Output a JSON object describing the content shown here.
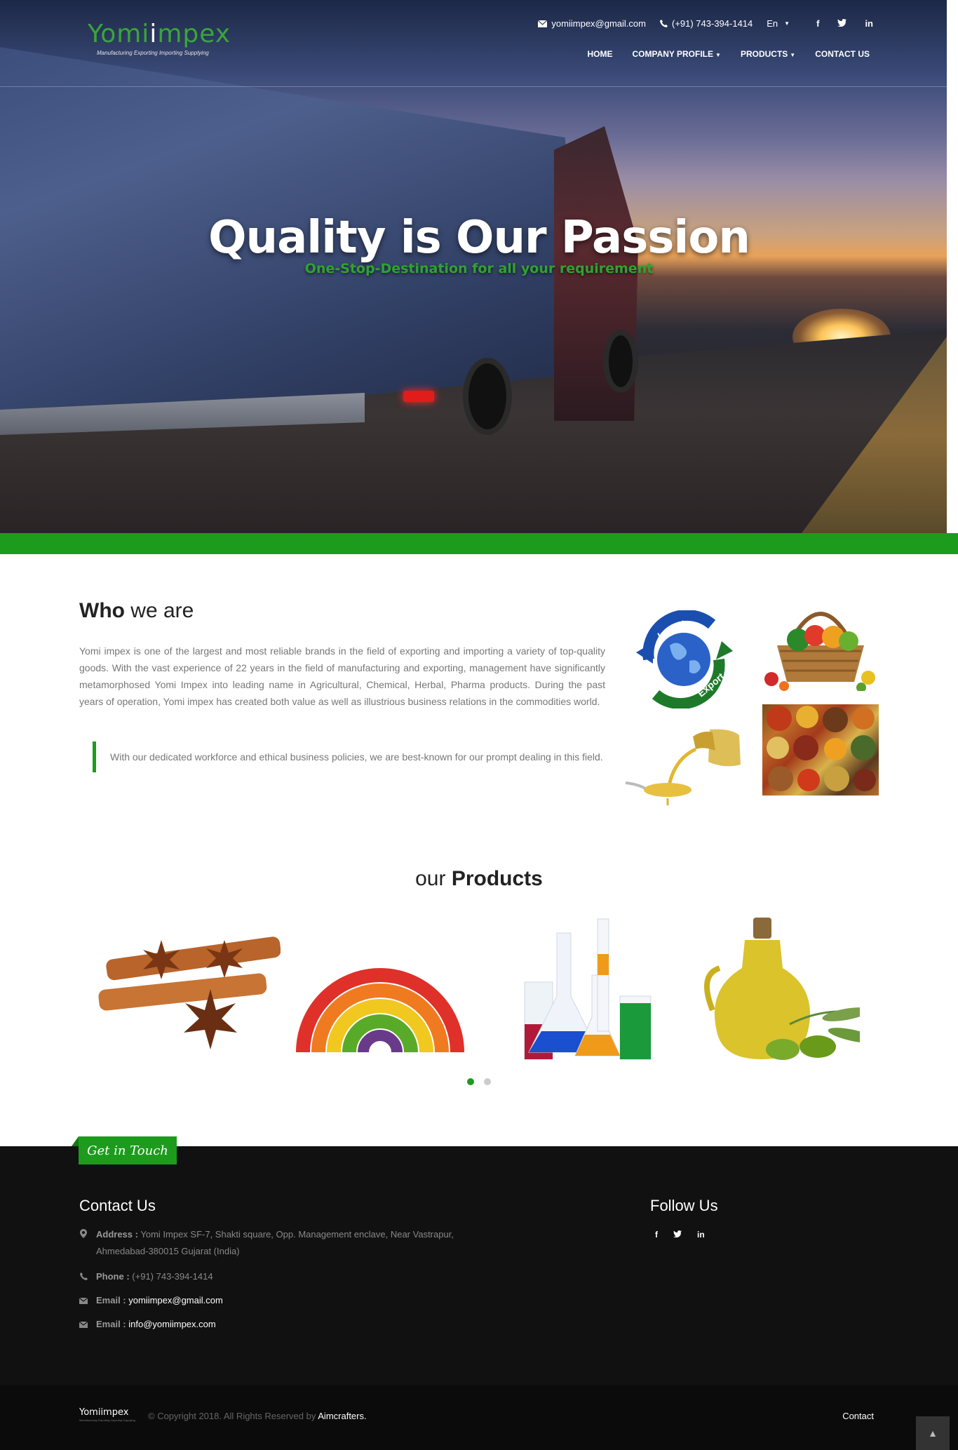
{
  "header": {
    "logo": {
      "name_lead": "Yomi",
      "name_i": "i",
      "name_tail": "mpex",
      "tagline": "Manufacturing Exporting Importing Supplying"
    },
    "email": "yomiimpex@gmail.com",
    "phone": "(+91) 743-394-1414",
    "language": "En",
    "social": {
      "facebook": "f",
      "twitter": "t",
      "linkedin": "in"
    },
    "nav": {
      "home": "HOME",
      "company_profile": "COMPANY PROFILE",
      "products": "PRODUCTS",
      "contact": "CONTACT US"
    }
  },
  "hero": {
    "title": "Quality is Our Passion",
    "subtitle": "One-Stop-Destination for all your requirement"
  },
  "who": {
    "title_bold": "Who",
    "title_rest": " we are",
    "body": "Yomi impex is one of the largest and most reliable brands in the field of exporting and importing a variety of top-quality goods. With the vast experience of 22 years in the field of manufacturing and exporting, management have significantly metamorphosed Yomi Impex into leading name in Agricultural, Chemical, Herbal, Pharma products. During the past years of operation, Yomi impex has created both value as well as illustrious business relations in the commodities world.",
    "quote": "With our dedicated workforce and ethical business policies, we are best-known for our prompt dealing in this field.",
    "globe_import": "Import",
    "globe_export": "Export"
  },
  "products": {
    "title_light": "our ",
    "title_bold": "Products",
    "slides": 2,
    "active_slide": 1
  },
  "footer": {
    "get_in_touch": "Get in Touch",
    "contact_heading": "Contact Us",
    "address_label": "Address :",
    "address_value": "Yomi Impex SF-7, Shakti square, Opp. Management enclave, Near Vastrapur, Ahmedabad-380015 Gujarat (India)",
    "phone_label": "Phone :",
    "phone_value": "(+91) 743-394-1414",
    "email_label": "Email :",
    "email_value_1": "yomiimpex@gmail.com",
    "email_value_2": "info@yomiimpex.com",
    "follow_heading": "Follow Us",
    "follow_icons": {
      "facebook": "f",
      "twitter": "t",
      "linkedin": "in"
    }
  },
  "bottom": {
    "logo_text": "Yomiimpex",
    "logo_tagline": "Manufacturing Exporting Importing Supplying",
    "copyright": "© Copyright 2018. All Rights Reserved by ",
    "author": "Aimcrafters.",
    "contact_link": "Contact"
  },
  "colors": {
    "accent_green": "#1d9b1d",
    "footer_bg": "#111111",
    "text_muted": "#777777"
  }
}
